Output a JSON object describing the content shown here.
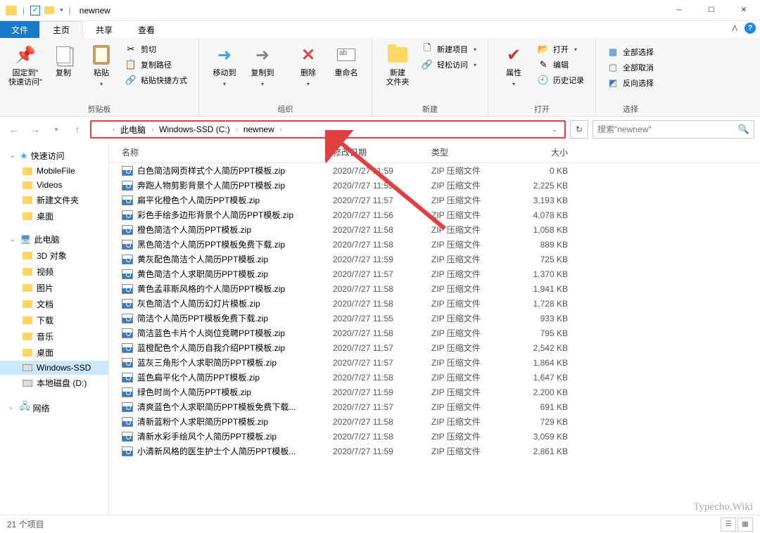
{
  "window": {
    "title": "newnew"
  },
  "tabs": {
    "file": "文件",
    "home": "主页",
    "share": "共享",
    "view": "查看"
  },
  "ribbon": {
    "clipboard": {
      "label": "剪贴板",
      "pin": "固定到\"\n快速访问\"",
      "copy": "复制",
      "paste": "粘贴",
      "cut": "剪切",
      "copy_path": "复制路径",
      "paste_shortcut": "粘贴快捷方式"
    },
    "organize": {
      "label": "组织",
      "moveto": "移动到",
      "copyto": "复制到",
      "delete": "删除",
      "rename": "重命名"
    },
    "new": {
      "label": "新建",
      "newfolder": "新建\n文件夹",
      "newitem": "新建项目",
      "easyaccess": "轻松访问"
    },
    "open": {
      "label": "打开",
      "properties": "属性",
      "open": "打开",
      "edit": "编辑",
      "history": "历史记录"
    },
    "select": {
      "label": "选择",
      "all": "全部选择",
      "none": "全部取消",
      "invert": "反向选择"
    }
  },
  "breadcrumb": {
    "items": [
      "此电脑",
      "Windows-SSD (C:)",
      "newnew"
    ]
  },
  "search": {
    "placeholder": "搜索\"newnew\""
  },
  "sidebar": {
    "quick": {
      "label": "快速访问",
      "items": [
        "MobileFile",
        "Videos",
        "新建文件夹",
        "桌面"
      ]
    },
    "pc": {
      "label": "此电脑",
      "items": [
        "3D 对象",
        "视频",
        "图片",
        "文档",
        "下载",
        "音乐",
        "桌面",
        "Windows-SSD",
        "本地磁盘 (D:)"
      ]
    },
    "net": {
      "label": "网络"
    }
  },
  "columns": {
    "name": "名称",
    "date": "修改日期",
    "type": "类型",
    "size": "大小"
  },
  "filetype": "ZIP 压缩文件",
  "files": [
    {
      "name": "白色简洁网页样式个人简历PPT模板.zip",
      "date": "2020/7/27 11:59",
      "size": "0 KB"
    },
    {
      "name": "奔跑人物剪影背景个人简历PPT模板.zip",
      "date": "2020/7/27 11:59",
      "size": "2,225 KB"
    },
    {
      "name": "扁平化橙色个人简历PPT模板.zip",
      "date": "2020/7/27 11:57",
      "size": "3,193 KB"
    },
    {
      "name": "彩色手绘多边形背景个人简历PPT模板.zip",
      "date": "2020/7/27 11:56",
      "size": "4,078 KB"
    },
    {
      "name": "橙色简洁个人简历PPT模板.zip",
      "date": "2020/7/27 11:58",
      "size": "1,058 KB"
    },
    {
      "name": "黑色简洁个人简历PPT模板免费下载.zip",
      "date": "2020/7/27 11:58",
      "size": "889 KB"
    },
    {
      "name": "黄灰配色简洁个人简历PPT模板.zip",
      "date": "2020/7/27 11:59",
      "size": "725 KB"
    },
    {
      "name": "黄色简洁个人求职简历PPT模板.zip",
      "date": "2020/7/27 11:57",
      "size": "1,370 KB"
    },
    {
      "name": "黄色孟菲斯风格的个人简历PPT模板.zip",
      "date": "2020/7/27 11:58",
      "size": "1,941 KB"
    },
    {
      "name": "灰色简洁个人简历幻灯片模板.zip",
      "date": "2020/7/27 11:58",
      "size": "1,728 KB"
    },
    {
      "name": "简洁个人简历PPT模板免费下载.zip",
      "date": "2020/7/27 11:55",
      "size": "933 KB"
    },
    {
      "name": "简洁蓝色卡片个人岗位竞聘PPT模板.zip",
      "date": "2020/7/27 11:58",
      "size": "795 KB"
    },
    {
      "name": "蓝橙配色个人简历自我介绍PPT模板.zip",
      "date": "2020/7/27 11:57",
      "size": "2,542 KB"
    },
    {
      "name": "蓝灰三角形个人求职简历PPT模板.zip",
      "date": "2020/7/27 11:57",
      "size": "1,864 KB"
    },
    {
      "name": "蓝色扁平化个人简历PPT模板.zip",
      "date": "2020/7/27 11:58",
      "size": "1,647 KB"
    },
    {
      "name": "绿色时尚个人简历PPT模板.zip",
      "date": "2020/7/27 11:59",
      "size": "2,200 KB"
    },
    {
      "name": "清爽蓝色个人求职简历PPT模板免费下载...",
      "date": "2020/7/27 11:57",
      "size": "691 KB"
    },
    {
      "name": "清新蓝粉个人求职简历PPT模板.zip",
      "date": "2020/7/27 11:58",
      "size": "729 KB"
    },
    {
      "name": "清新水彩手绘风个人简历PPT模板.zip",
      "date": "2020/7/27 11:58",
      "size": "3,059 KB"
    },
    {
      "name": "小清新风格的医生护士个人简历PPT模板...",
      "date": "2020/7/27 11:59",
      "size": "2,861 KB"
    }
  ],
  "status": {
    "count": "21 个项目"
  },
  "watermark": "Typecho.Wiki"
}
